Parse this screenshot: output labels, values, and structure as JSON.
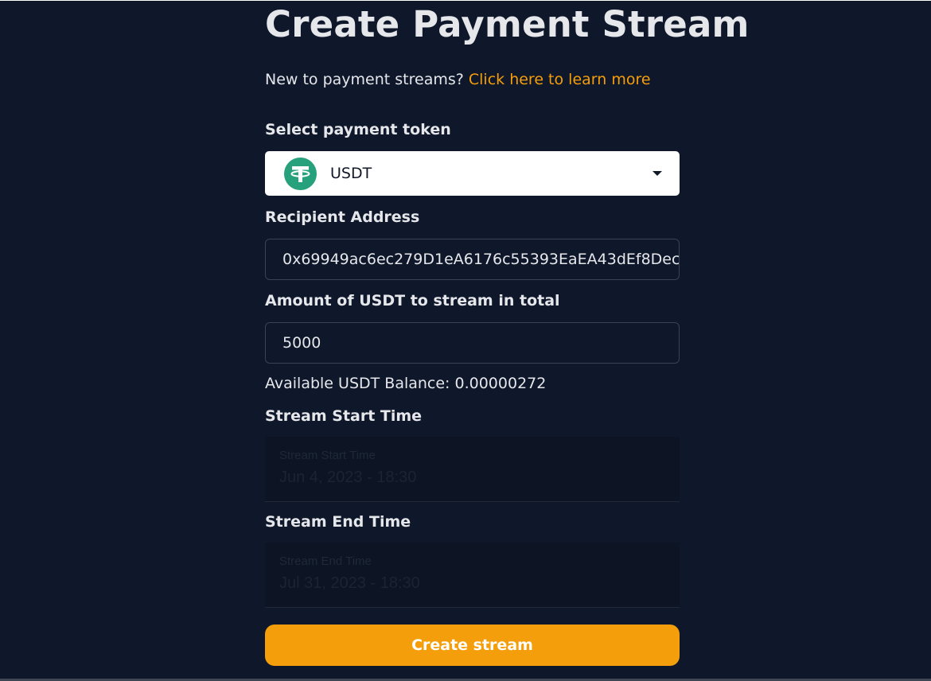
{
  "page": {
    "title": "Create Payment Stream",
    "intro_text": "New to payment streams?",
    "intro_link": "Click here to learn more"
  },
  "token": {
    "label": "Select payment token",
    "selected": "USDT",
    "icon": "tether-icon",
    "icon_color": "#26a17b"
  },
  "recipient": {
    "label": "Recipient Address",
    "value": "0x69949ac6ec279D1eA6176c55393EaEA43dEf8Dec"
  },
  "amount": {
    "label": "Amount of USDT to stream in total",
    "value": "5000"
  },
  "balance": {
    "text": "Available USDT Balance: 0.00000272"
  },
  "start_time": {
    "label": "Stream Start Time",
    "field_label": "Stream Start Time",
    "value": "Jun 4, 2023 - 18:30"
  },
  "end_time": {
    "label": "Stream End Time",
    "field_label": "Stream End Time",
    "value": "Jul 31, 2023 - 18:30"
  },
  "submit": {
    "label": "Create stream"
  },
  "colors": {
    "background": "#0f172a",
    "accent": "#f59e0b",
    "text": "#e5e7eb"
  }
}
